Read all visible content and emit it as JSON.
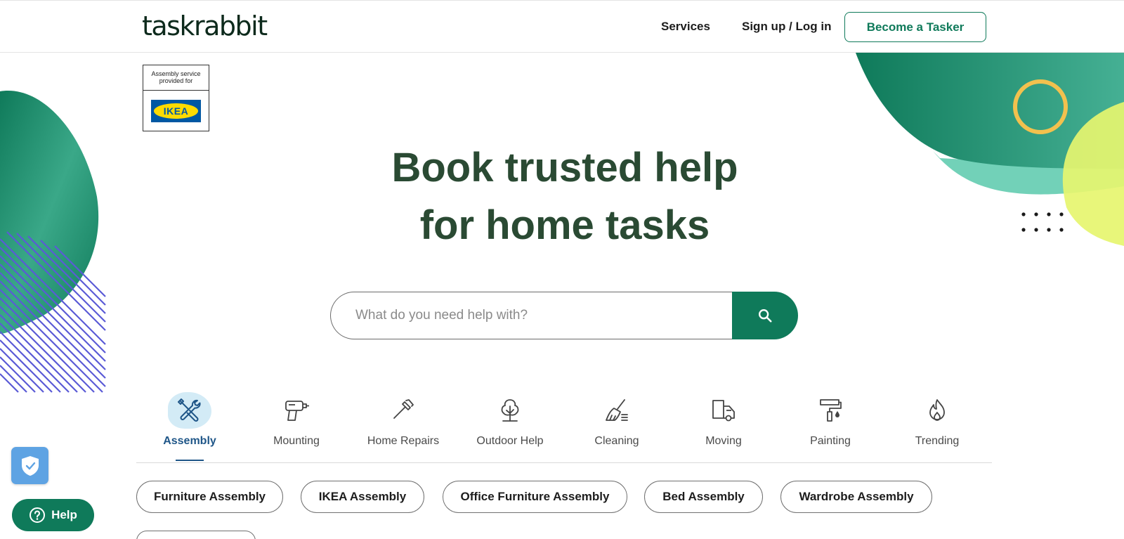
{
  "header": {
    "logo": "taskrabbit",
    "nav": {
      "services": "Services",
      "login": "Sign up / Log in"
    },
    "cta": "Become a Tasker"
  },
  "ikea_badge": {
    "caption_line1": "Assembly service",
    "caption_line2": "provided for",
    "logo_text": "IKEA"
  },
  "hero": {
    "title_line1": "Book trusted help",
    "title_line2": "for home tasks"
  },
  "search": {
    "placeholder": "What do you need help with?",
    "value": "",
    "button_icon": "search-icon"
  },
  "categories": [
    {
      "label": "Assembly",
      "icon": "tools-icon",
      "active": true
    },
    {
      "label": "Mounting",
      "icon": "drill-icon",
      "active": false
    },
    {
      "label": "Home Repairs",
      "icon": "hammer-icon",
      "active": false
    },
    {
      "label": "Outdoor Help",
      "icon": "tree-icon",
      "active": false
    },
    {
      "label": "Cleaning",
      "icon": "broom-icon",
      "active": false
    },
    {
      "label": "Moving",
      "icon": "truck-icon",
      "active": false
    },
    {
      "label": "Painting",
      "icon": "paint-roller-icon",
      "active": false
    },
    {
      "label": "Trending",
      "icon": "flame-icon",
      "active": false
    }
  ],
  "chips": [
    "Furniture Assembly",
    "IKEA Assembly",
    "Office Furniture Assembly",
    "Bed Assembly",
    "Wardrobe Assembly"
  ],
  "floating": {
    "help_label": "Help",
    "shield_icon": "shield-check-icon"
  },
  "colors": {
    "brand_green": "#0f7a5a",
    "hero_text": "#2a4a33",
    "active_blue": "#1f5688",
    "accent_yellow": "#f2c14e",
    "lime": "#e6f56f",
    "stripe_purple": "#5a5ad6"
  }
}
